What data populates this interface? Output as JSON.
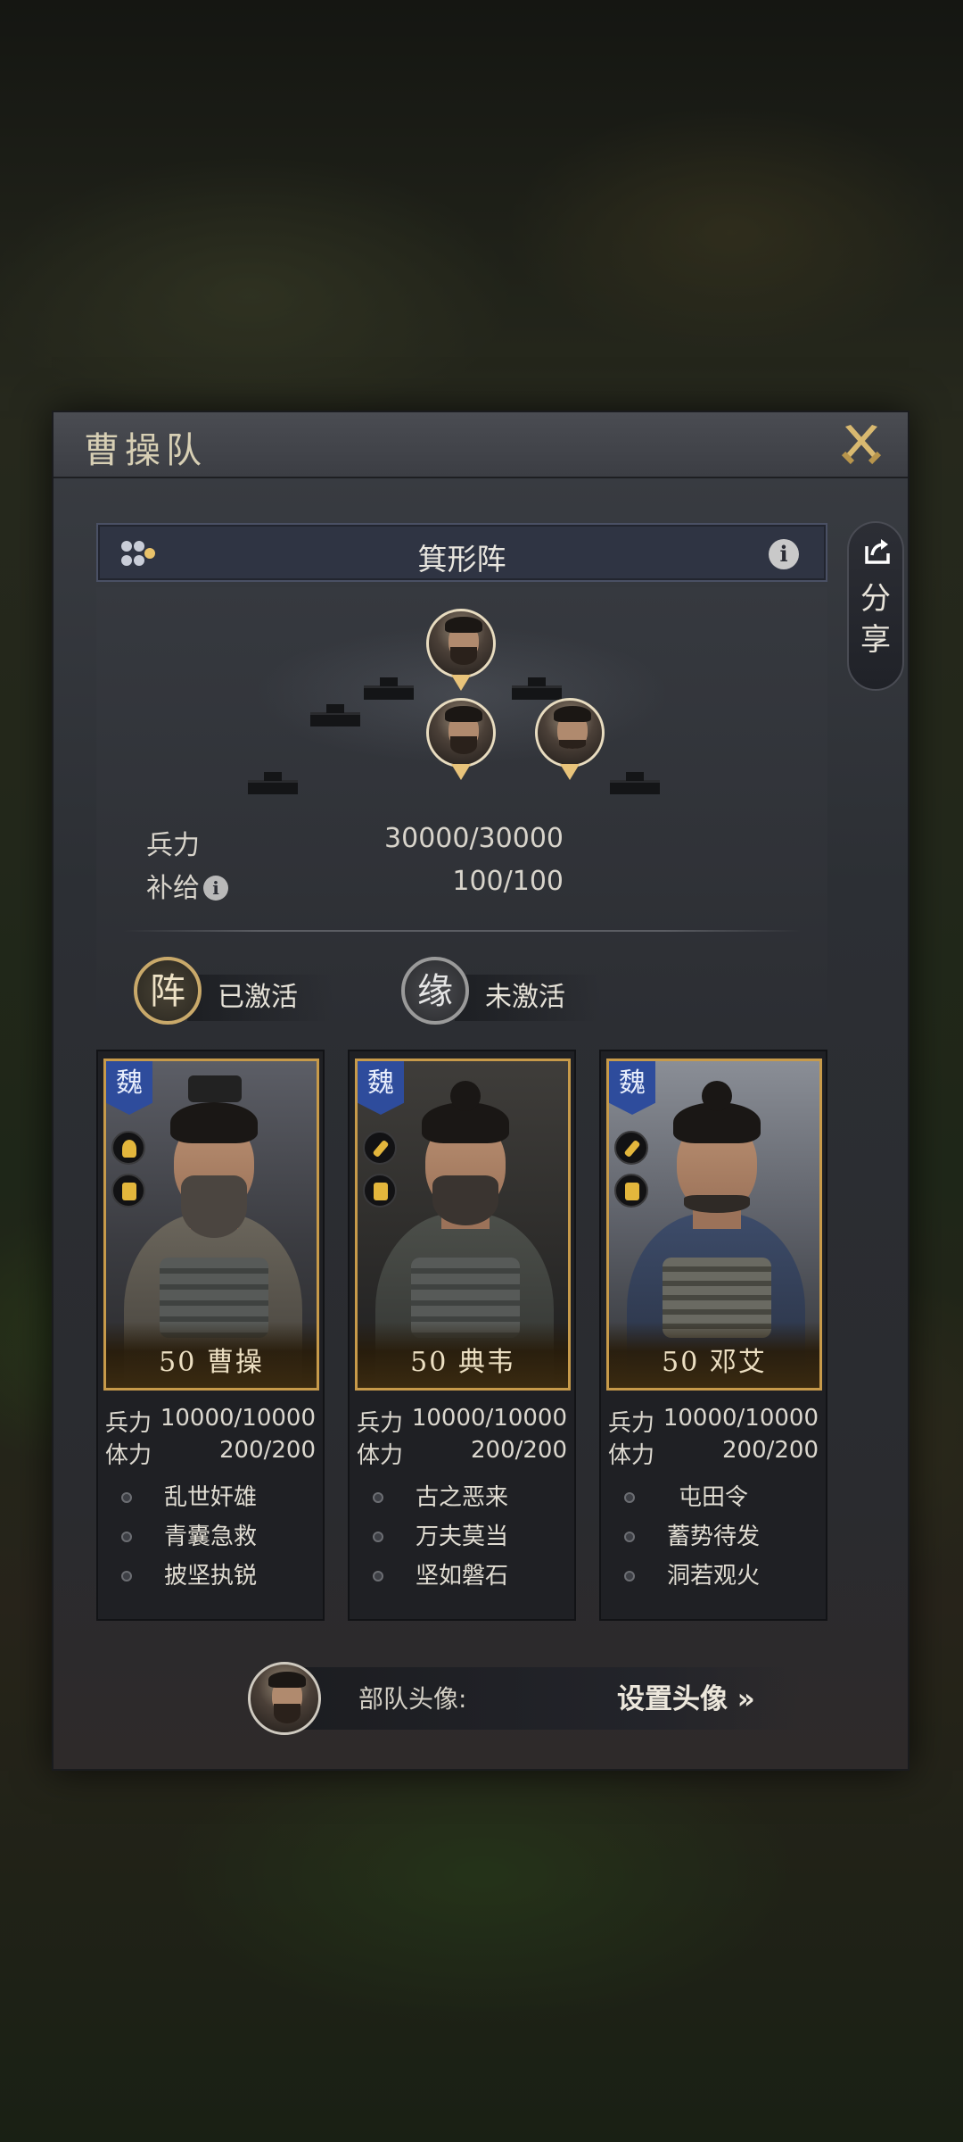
{
  "panel": {
    "title": "曹操队",
    "close_icon": "crossed-swords-close-icon"
  },
  "formation": {
    "name": "箕形阵",
    "share_label": "分享"
  },
  "stats": {
    "troops_label": "兵力",
    "troops_value": "30000/30000",
    "supply_label": "补给",
    "supply_value": "100/100"
  },
  "bonds": [
    {
      "badge": "阵",
      "status": "已激活",
      "badge_color": "#c9a96a"
    },
    {
      "badge": "缘",
      "status": "未激活",
      "badge_color": "#9a9a9a"
    }
  ],
  "generals": [
    {
      "faction": "魏",
      "name": "50 曹操",
      "troops_label": "兵力",
      "troops": "10000/10000",
      "stamina_label": "体力",
      "stamina": "200/200",
      "skills": [
        "乱世奸雄",
        "青囊急救",
        "披坚执锐"
      ]
    },
    {
      "faction": "魏",
      "name": "50 典韦",
      "troops_label": "兵力",
      "troops": "10000/10000",
      "stamina_label": "体力",
      "stamina": "200/200",
      "skills": [
        "古之恶来",
        "万夫莫当",
        "坚如磐石"
      ]
    },
    {
      "faction": "魏",
      "name": "50 邓艾",
      "troops_label": "兵力",
      "troops": "10000/10000",
      "stamina_label": "体力",
      "stamina": "200/200",
      "skills": [
        "屯田令",
        "蓄势待发",
        "洞若观火"
      ]
    }
  ],
  "avatar": {
    "label": "部队头像:",
    "set_button": "设置头像 »"
  },
  "colors": {
    "accent_gold": "#c79a4a",
    "faction_wei": "#2e4c9c"
  }
}
